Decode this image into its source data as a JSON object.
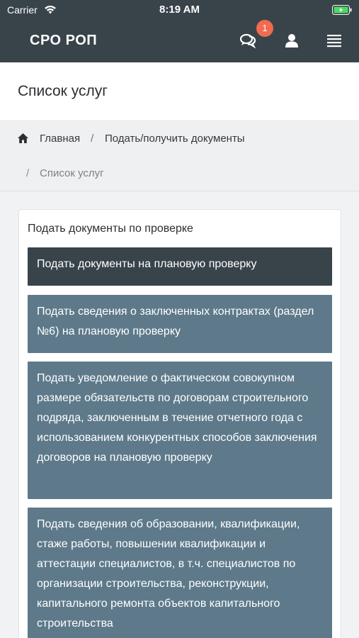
{
  "status_bar": {
    "carrier": "Carrier",
    "time": "8:19 AM",
    "icons": [
      "wifi-icon",
      "battery-charging-icon"
    ]
  },
  "header": {
    "brand": "СРО РОП",
    "notification_count": "1",
    "icons": [
      "chat-icon",
      "user-icon",
      "menu-icon"
    ],
    "background_color": "#39444a",
    "badge_color": "#f06b4f"
  },
  "page": {
    "title": "Список услуг"
  },
  "breadcrumb": {
    "home": "Главная",
    "separator": "/",
    "docs": "Подать/получить документы",
    "current": "Список услуг"
  },
  "card": {
    "heading": "Подать документы по проверке",
    "items": [
      {
        "label": "Подать документы на плановую проверку"
      },
      {
        "label": "Подать сведения о заключенных контрактах (раздел №6) на плановую проверку"
      },
      {
        "label": "Подать уведомление о фактическом совокупном размере обязательств по договорам строительного подряда, заключенным в течение отчетного года с использованием конкурентных способов заключения договоров на плановую проверку"
      },
      {
        "label": "Подать сведения об образовании, квалификации, стаже работы, повышении квалификации и аттестации специалистов, в т.ч. специалистов по организации строительства, реконструкции, капитального ремонта объектов капитального строительства"
      }
    ],
    "item_color": "#5e7a8a",
    "active_item_color": "#39444a"
  }
}
